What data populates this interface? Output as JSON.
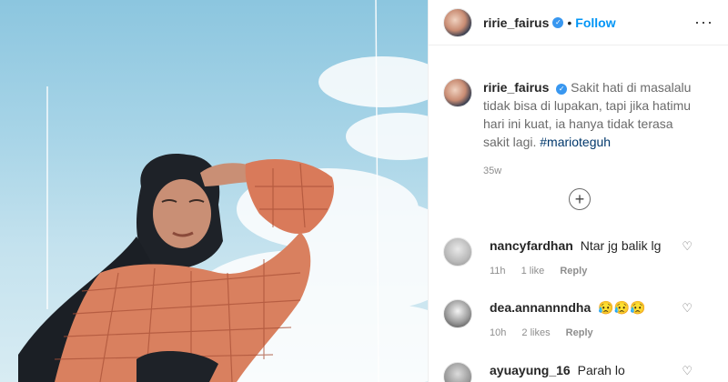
{
  "post": {
    "username": "ririe_fairus",
    "follow_label": "Follow",
    "separator": "•",
    "more_glyph": "···",
    "verified_glyph": "✓",
    "caption": "Sakit hati di masalalu tidak bisa di lupakan, tapi jika hatimu hari ini kuat, ia hanya tidak terasa sakit lagi.",
    "hashtag": "#marioteguh",
    "time": "35w",
    "load_more_glyph": "+"
  },
  "comments": [
    {
      "username": "nancyfardhan",
      "text": "Ntar jg balik lg",
      "time": "11h",
      "likes": "1 like",
      "reply": "Reply"
    },
    {
      "username": "dea.annannndha",
      "text": "😥😥😥",
      "time": "10h",
      "likes": "2 likes",
      "reply": "Reply"
    },
    {
      "username": "ayuayung_16",
      "text": "Parah lo",
      "time": "",
      "likes": "",
      "reply": ""
    }
  ],
  "icons": {
    "like": "heart-outline-icon",
    "more": "more-options-icon",
    "load_more": "plus-circle-icon",
    "verified": "verified-badge-icon"
  },
  "colors": {
    "accent": "#0095f6",
    "verified": "#3897f0",
    "hashtag": "#00376b",
    "muted": "#8e8e8e"
  }
}
